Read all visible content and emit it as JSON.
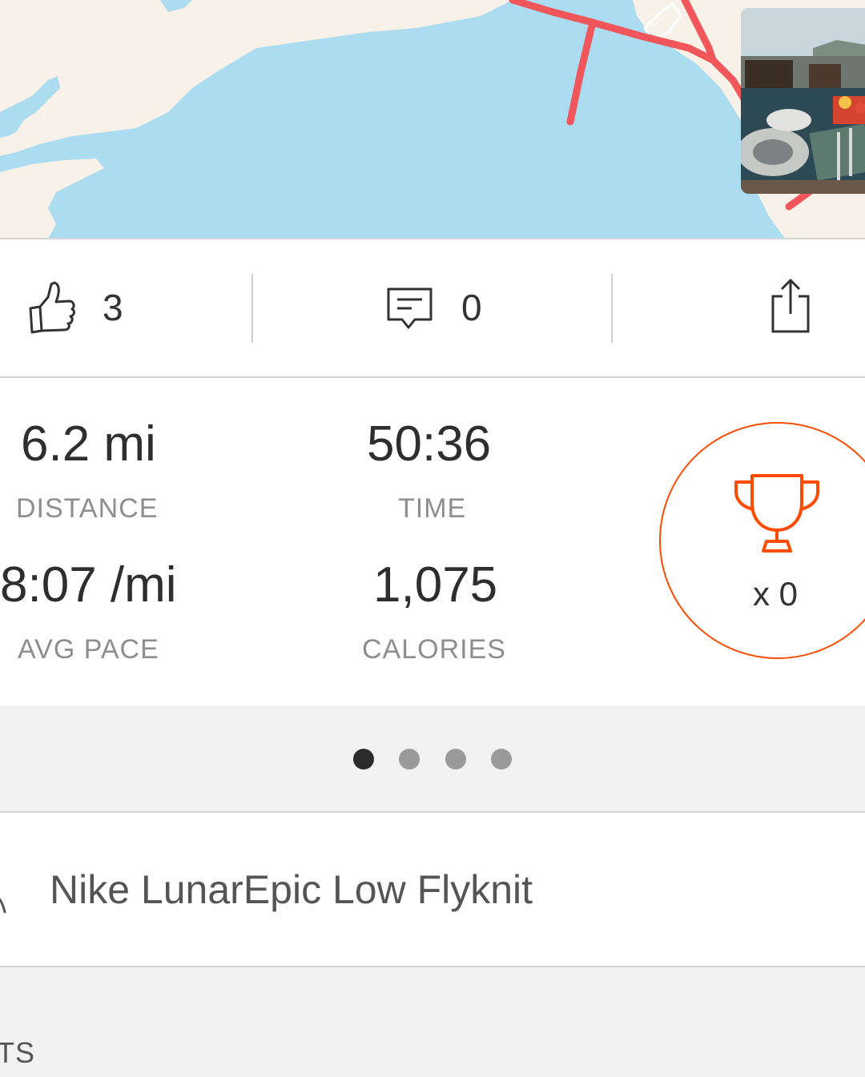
{
  "map": {
    "photo_alt": "Breakfast table on a terrace"
  },
  "social": {
    "kudos_count": "3",
    "comment_count": "0"
  },
  "stats": {
    "distance_value": "6.2 mi",
    "distance_label": "DISTANCE",
    "time_value": "50:36",
    "time_label": "TIME",
    "pace_value": "8:07 /mi",
    "pace_label": "AVG PACE",
    "calories_value": "1,075",
    "calories_label": "CALORIES"
  },
  "achievements": {
    "count_text": "x 0"
  },
  "pager": {
    "total": 4,
    "active_index": 0
  },
  "gear": {
    "label": "Nike LunarEpic Low Flyknit"
  },
  "bottom_section": {
    "label_fragment": "TS"
  },
  "colors": {
    "accent": "#fc4c02",
    "route": "#f0565a",
    "water": "#abdcef",
    "land": "#f7f1e8"
  }
}
